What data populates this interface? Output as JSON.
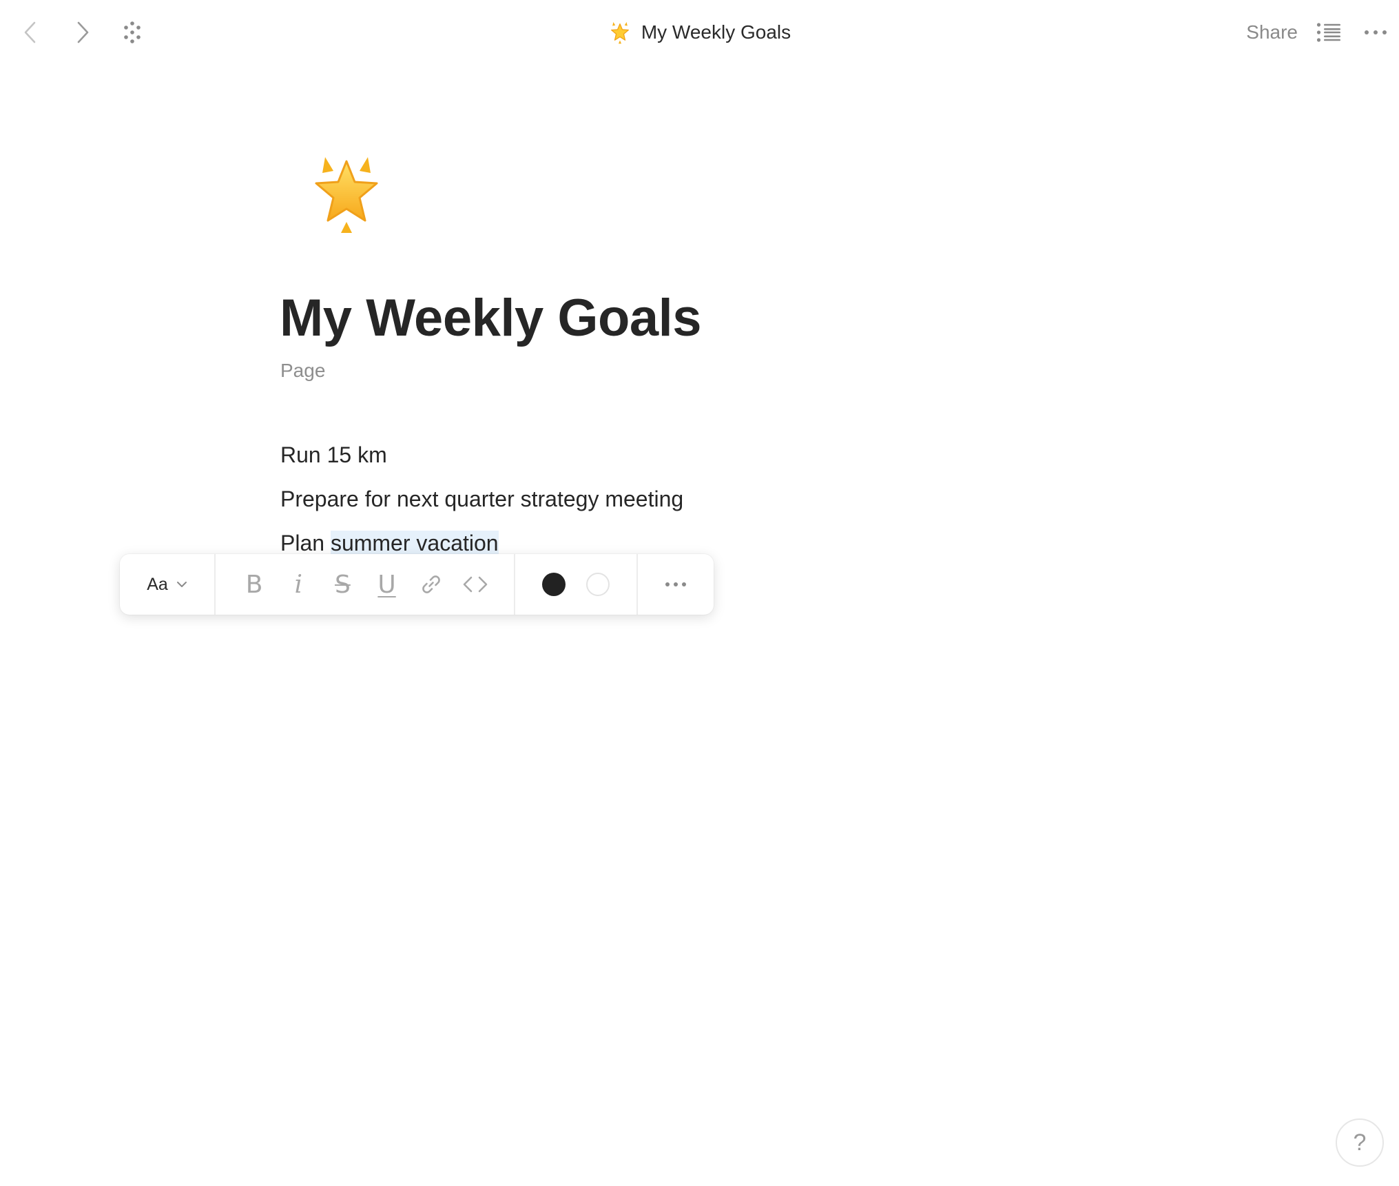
{
  "topbar": {
    "title": "My Weekly Goals",
    "share_label": "Share"
  },
  "page": {
    "icon": "glowing-star",
    "title": "My Weekly Goals",
    "subtitle": "Page",
    "lines": [
      {
        "text": "Run 15 km"
      },
      {
        "text": "Prepare for next quarter strategy meeting"
      },
      {
        "prefix": "Plan ",
        "selected": "summer vacation"
      }
    ]
  },
  "toolbar": {
    "text_style_label": "Aa",
    "bold_glyph": "B",
    "italic_glyph": "i",
    "strike_glyph": "S",
    "underline_glyph": "U",
    "text_color": "#222222",
    "background_color": "#ffffff"
  },
  "help": {
    "label": "?"
  },
  "colors": {
    "selection": "#e6f1fb",
    "icon_gray": "#a8a8a8",
    "star_fill": "#ffcc33",
    "star_edge": "#f2a51a"
  }
}
